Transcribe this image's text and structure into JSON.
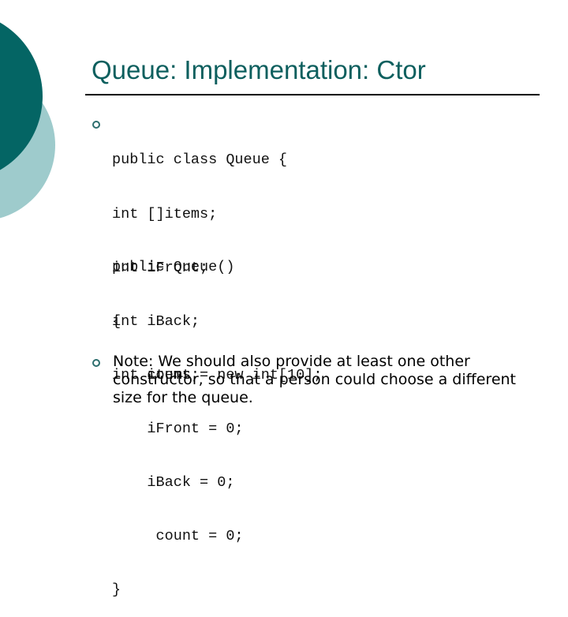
{
  "slide": {
    "title": "Queue: Implementation: Ctor",
    "colors": {
      "accent_dark": "#046564",
      "accent_light": "#9ecbcc",
      "title": "#0d5f5e"
    },
    "code_block_1": [
      "public class Queue {",
      "int []items;",
      "int iFront;",
      "int iBack;",
      "int count;"
    ],
    "code_block_2": [
      "public Queue()",
      "{",
      "    items = new int[10];",
      "    iFront = 0;",
      "    iBack = 0;",
      "     count = 0;",
      "}"
    ],
    "note": "Note: We should also provide at least one other constructor, so that a person could choose a different size for the queue."
  }
}
